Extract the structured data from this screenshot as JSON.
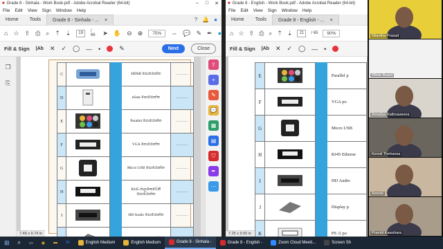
{
  "window_left": {
    "title": "Grade 8 - Sinhala - Work Book.pdf - Adobe Acrobat Reader (64-bit)",
    "menu": [
      "File",
      "Edit",
      "View",
      "Sign",
      "Window",
      "Help"
    ],
    "tabs": {
      "home": "Home",
      "tools": "Tools",
      "doc": "Grade 8 - Sinhala - ...",
      "doc_close": "×"
    },
    "page_current": "19",
    "page_total": "/ 66",
    "zoom": "75%",
    "fill_sign": {
      "label": "Fill & Sign",
      "text_tool": "|Ab",
      "next": "Next",
      "close": "Close"
    },
    "status_size": "7.49 x 9.74 in",
    "rows": [
      {
        "letter": "C",
        "label": "HDMI පොරොත්ත",
        "dash": "..............",
        "blue": false
      },
      {
        "letter": "D",
        "label": "eSata පොරොත්ත",
        "dash": "..............",
        "blue": true
      },
      {
        "letter": "E",
        "label": "Parallel පොරොත්ත",
        "dash": "..............",
        "blue": false
      },
      {
        "letter": "F",
        "label": "VGA පොරොත්ත",
        "dash": "..............",
        "blue": true
      },
      {
        "letter": "G",
        "label": "Micro USB පොරොත්ත",
        "dash": "..............",
        "blue": false
      },
      {
        "letter": "H",
        "label": "RJ45 ජාලකෙවෙනි පොරොත්ත",
        "dash": "..............",
        "blue": true
      },
      {
        "letter": "I",
        "label": "HD Audio පොරොත්ත",
        "dash": "..............",
        "blue": false
      },
      {
        "letter": "J",
        "label": "Display පොරොත්ත",
        "dash": "..............",
        "blue": true
      }
    ]
  },
  "window_right": {
    "title": "Grade 8 - English - Work Book.pdf - Adobe Acrobat Reader (64-bit)",
    "menu": [
      "File",
      "Edit",
      "View",
      "Sign",
      "Window",
      "Help"
    ],
    "tabs": {
      "home": "Home",
      "tools": "Tools",
      "doc": "Grade 8 - English - ...",
      "doc_close": "×"
    },
    "page_current": "21",
    "page_total": "/ 65",
    "zoom": "90%",
    "fill_sign": {
      "label": "Fill & Sign",
      "text_tool": "|Ab"
    },
    "status_size": "7.25 x 9.50 in",
    "rows": [
      {
        "letter": "E",
        "label": "Parallel p",
        "blue": true
      },
      {
        "letter": "F",
        "label": "VGA po",
        "blue": false
      },
      {
        "letter": "G",
        "label": "Micro USB",
        "blue": true
      },
      {
        "letter": "H",
        "label": "RJ45 Etherne",
        "blue": false
      },
      {
        "letter": "I",
        "label": "HD Audio",
        "blue": true
      },
      {
        "letter": "J",
        "label": "Display p",
        "blue": false
      },
      {
        "letter": "K",
        "label": "PS /2 po",
        "blue": true
      }
    ]
  },
  "participants": [
    {
      "name": "Nilantha Prasad",
      "bg": "#e8cf3a"
    },
    {
      "name": "White Board",
      "bg": "#f2f2f2"
    },
    {
      "name": "Amadya Rathnaweera",
      "bg": "#d9d4cc"
    },
    {
      "name": "Kenoli Thehansa",
      "bg": "#6a665e"
    },
    {
      "name": "Amindi",
      "bg": "#c9b89f"
    },
    {
      "name": "Pranidi Kawshara",
      "bg": "#a99c8a"
    }
  ],
  "taskbar": {
    "items": [
      {
        "label": "English Medium",
        "color": "#e8b43a",
        "active": false
      },
      {
        "label": "English Medium",
        "color": "#e8b43a",
        "active": false
      },
      {
        "label": "Grade 8 - Sinhala -",
        "color": "#d62b2b",
        "active": true
      },
      {
        "label": "Grade 8 - English -",
        "color": "#d62b2b",
        "active": false
      },
      {
        "label": "Zoom Cloud Meeti...",
        "color": "#2d8cff",
        "active": false
      },
      {
        "label": "Screen Sh",
        "color": "#444",
        "active": false
      }
    ]
  }
}
